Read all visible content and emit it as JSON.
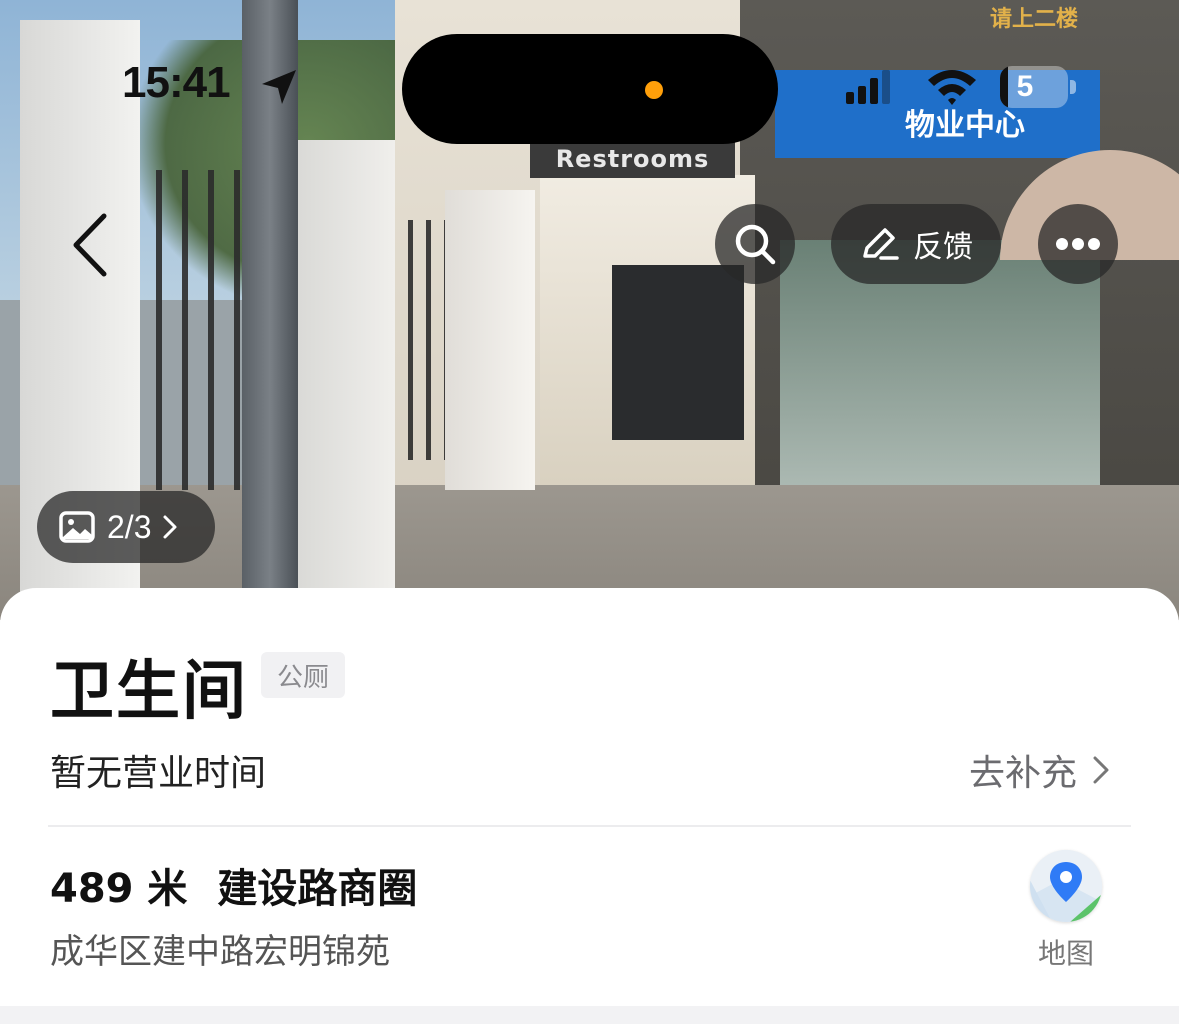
{
  "status_bar": {
    "time": "15:41",
    "battery_level": "5",
    "battery_fraction": 0.05,
    "icons": [
      "location-arrow-icon",
      "cellular-signal-icon",
      "wifi-icon",
      "battery-icon"
    ]
  },
  "photo": {
    "sign_text": "Restrooms",
    "top_sign": "请上二楼",
    "blue_sign": "物业中心",
    "gallery_counter": "2/3",
    "gallery_icon": "image-icon"
  },
  "actions": {
    "back_icon": "chevron-left-icon",
    "search_icon": "search-icon",
    "feedback_label": "反馈",
    "feedback_icon": "pencil-icon",
    "more_icon": "more-dots-icon"
  },
  "place": {
    "name": "卫生间",
    "tag": "公厕",
    "hours": "暂无营业时间",
    "supplement_label": "去补充",
    "distance": "489 米",
    "district": "建设路商圈",
    "address": "成华区建中路宏明锦苑",
    "map_label": "地图"
  },
  "colors": {
    "accent_blue": "#2f7bf6",
    "status_dot": "#ff9f0a",
    "map_green": "#5cc36a"
  }
}
